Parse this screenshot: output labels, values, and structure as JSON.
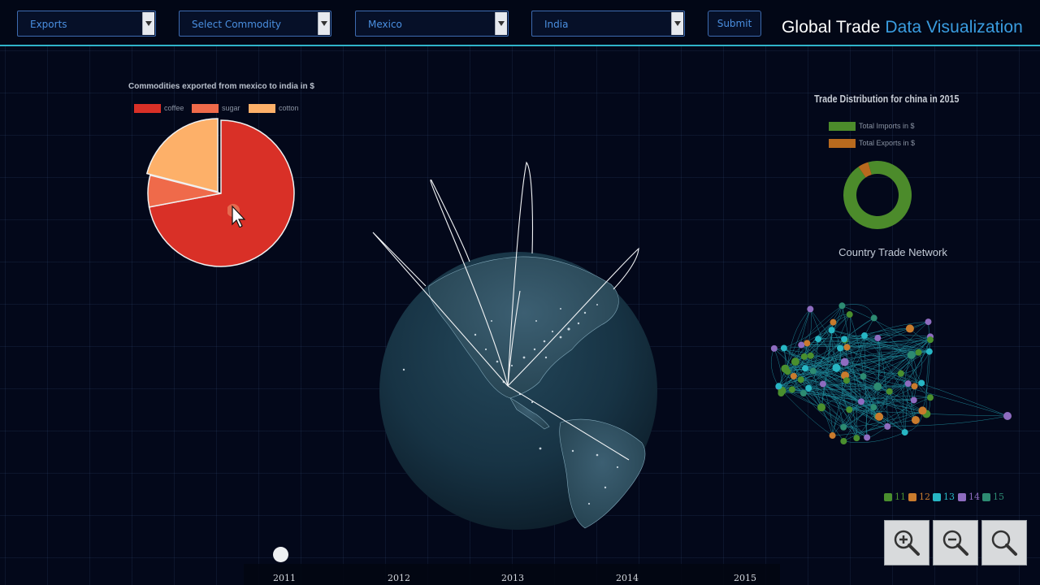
{
  "toolbar": {
    "flow_select": "Exports",
    "commodity_select": "Select Commodity",
    "from_select": "Mexico",
    "to_select": "India",
    "submit_label": "Submit",
    "title_prefix": "Global Trade",
    "title_accent": "Data Visualization"
  },
  "colors": {
    "accent": "#3a9de0",
    "header_line": "#2fb3c9",
    "background": "#03081a"
  },
  "commodity_pie": {
    "title": "Commodities exported from mexico to india in $",
    "legend": [
      {
        "label": "coffee",
        "color": "#d93027"
      },
      {
        "label": "sugar",
        "color": "#ef6a4a"
      },
      {
        "label": "cotton",
        "color": "#fdb069"
      }
    ]
  },
  "trade_distribution": {
    "title": "Trade Distribution for china in 2015",
    "legend": [
      {
        "label": "Total Imports in $",
        "color": "#4c8b2b"
      },
      {
        "label": "Total Exports in $",
        "color": "#b86a1e"
      }
    ]
  },
  "network": {
    "title": "Country Trade Network",
    "legend": [
      {
        "label": "11",
        "color": "#4a8f2e"
      },
      {
        "label": "12",
        "color": "#c97b2d"
      },
      {
        "label": "13",
        "color": "#27b6c4"
      },
      {
        "label": "14",
        "color": "#8e6cc0"
      },
      {
        "label": "15",
        "color": "#2d8b72"
      }
    ]
  },
  "timeline": {
    "years": [
      "2011",
      "2012",
      "2013",
      "2014",
      "2015"
    ],
    "selected": "2011"
  },
  "zoom_controls": {
    "icons": [
      "zoom-in-icon",
      "zoom-out-icon",
      "zoom-reset-icon"
    ]
  },
  "chart_data": [
    {
      "type": "pie",
      "title": "Commodities exported from mexico to india in $",
      "categories": [
        "coffee",
        "sugar",
        "cotton"
      ],
      "values": [
        72,
        7,
        21
      ]
    },
    {
      "type": "pie",
      "title": "Trade Distribution for china in 2015",
      "categories": [
        "Total Imports in $",
        "Total Exports in $"
      ],
      "values": [
        95,
        5
      ]
    }
  ]
}
